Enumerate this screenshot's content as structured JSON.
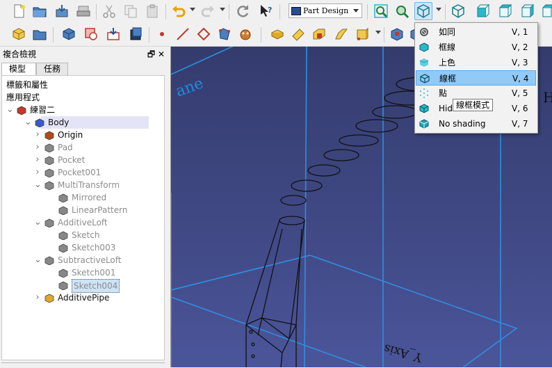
{
  "toolbar1": {
    "workbench": "Part Design"
  },
  "toolbar2": {},
  "panel": {
    "title": "複合檢視",
    "controls": "🗗 ✕",
    "tabs": [
      "模型",
      "任務"
    ],
    "sections": [
      "標籤和屬性",
      "應用程式"
    ],
    "tree": [
      {
        "label": "練習二",
        "level": 0,
        "expander": "v",
        "grey": false
      },
      {
        "label": "Body",
        "level": 1,
        "expander": "v",
        "grey": false
      },
      {
        "label": "Origin",
        "level": 2,
        "expander": ">",
        "grey": false
      },
      {
        "label": "Pad",
        "level": 2,
        "expander": ">",
        "grey": true
      },
      {
        "label": "Pocket",
        "level": 2,
        "expander": ">",
        "grey": true
      },
      {
        "label": "Pocket001",
        "level": 2,
        "expander": ">",
        "grey": true
      },
      {
        "label": "MultiTransform",
        "level": 2,
        "expander": "v",
        "grey": true
      },
      {
        "label": "Mirrored",
        "level": 3,
        "expander": "",
        "grey": true
      },
      {
        "label": "LinearPattern",
        "level": 3,
        "expander": "",
        "grey": true
      },
      {
        "label": "AdditiveLoft",
        "level": 2,
        "expander": "v",
        "grey": true
      },
      {
        "label": "Sketch",
        "level": 3,
        "expander": "",
        "grey": true
      },
      {
        "label": "Sketch003",
        "level": 3,
        "expander": "",
        "grey": true
      },
      {
        "label": "SubtractiveLoft",
        "level": 2,
        "expander": "v",
        "grey": true
      },
      {
        "label": "Sketch001",
        "level": 3,
        "expander": "",
        "grey": true
      },
      {
        "label": "Sketch004",
        "level": 3,
        "expander": "",
        "grey": true
      },
      {
        "label": "AdditivePipe",
        "level": 2,
        "expander": ">",
        "grey": false
      }
    ]
  },
  "viewport": {
    "plane_label": "ane",
    "axis_label": "Y_Axis",
    "corner_label": "H"
  },
  "draw_style_menu": {
    "items": [
      {
        "label": "如同",
        "shortcut": "V, 1"
      },
      {
        "label": "框線",
        "shortcut": "V, 2"
      },
      {
        "label": "上色",
        "shortcut": "V, 3"
      },
      {
        "label": "線框",
        "shortcut": "V, 4"
      },
      {
        "label": "點",
        "shortcut": "V, 5"
      },
      {
        "label": "Hidden line",
        "shortcut": "V, 6"
      },
      {
        "label": "No shading",
        "shortcut": "V, 7"
      }
    ],
    "highlighted_index": 3
  },
  "tooltip": "線框模式",
  "colors": {
    "accent": "#91c9f7",
    "viewport_top": "#343c6e",
    "viewport_bottom": "#4b559a",
    "grid": "#2e8fe0",
    "cyan_icon": "#2bb7c9"
  }
}
